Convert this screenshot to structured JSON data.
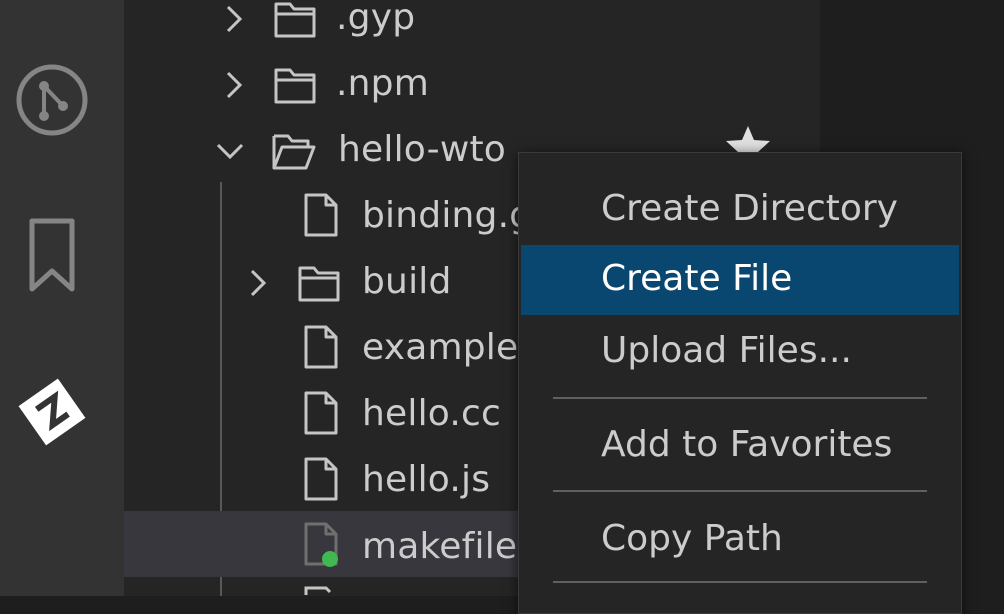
{
  "activity_bar": {
    "icons": [
      "source-control-icon",
      "bookmark-icon",
      "zowe-explorer-icon"
    ]
  },
  "explorer": {
    "items": [
      {
        "label": ".gyp",
        "type": "folder",
        "expanded": false
      },
      {
        "label": ".npm",
        "type": "folder",
        "expanded": false
      },
      {
        "label": "hello-wto",
        "type": "folder",
        "expanded": true
      },
      {
        "label": "binding.g",
        "type": "file"
      },
      {
        "label": "build",
        "type": "folder",
        "expanded": false
      },
      {
        "label": "example.t",
        "type": "file"
      },
      {
        "label": "hello.cc",
        "type": "file"
      },
      {
        "label": "hello.js",
        "type": "file"
      },
      {
        "label": "makefile",
        "type": "file",
        "selected": true,
        "status_color": "#3fb950"
      }
    ]
  },
  "context_menu": {
    "items": [
      {
        "label": "Create Directory"
      },
      {
        "label": "Create File",
        "active": true
      },
      {
        "label": "Upload Files..."
      },
      {
        "label": "Add to Favorites"
      },
      {
        "label": "Copy Path"
      }
    ]
  },
  "colors": {
    "selection": "#094771",
    "git_added": "#3fb950"
  }
}
